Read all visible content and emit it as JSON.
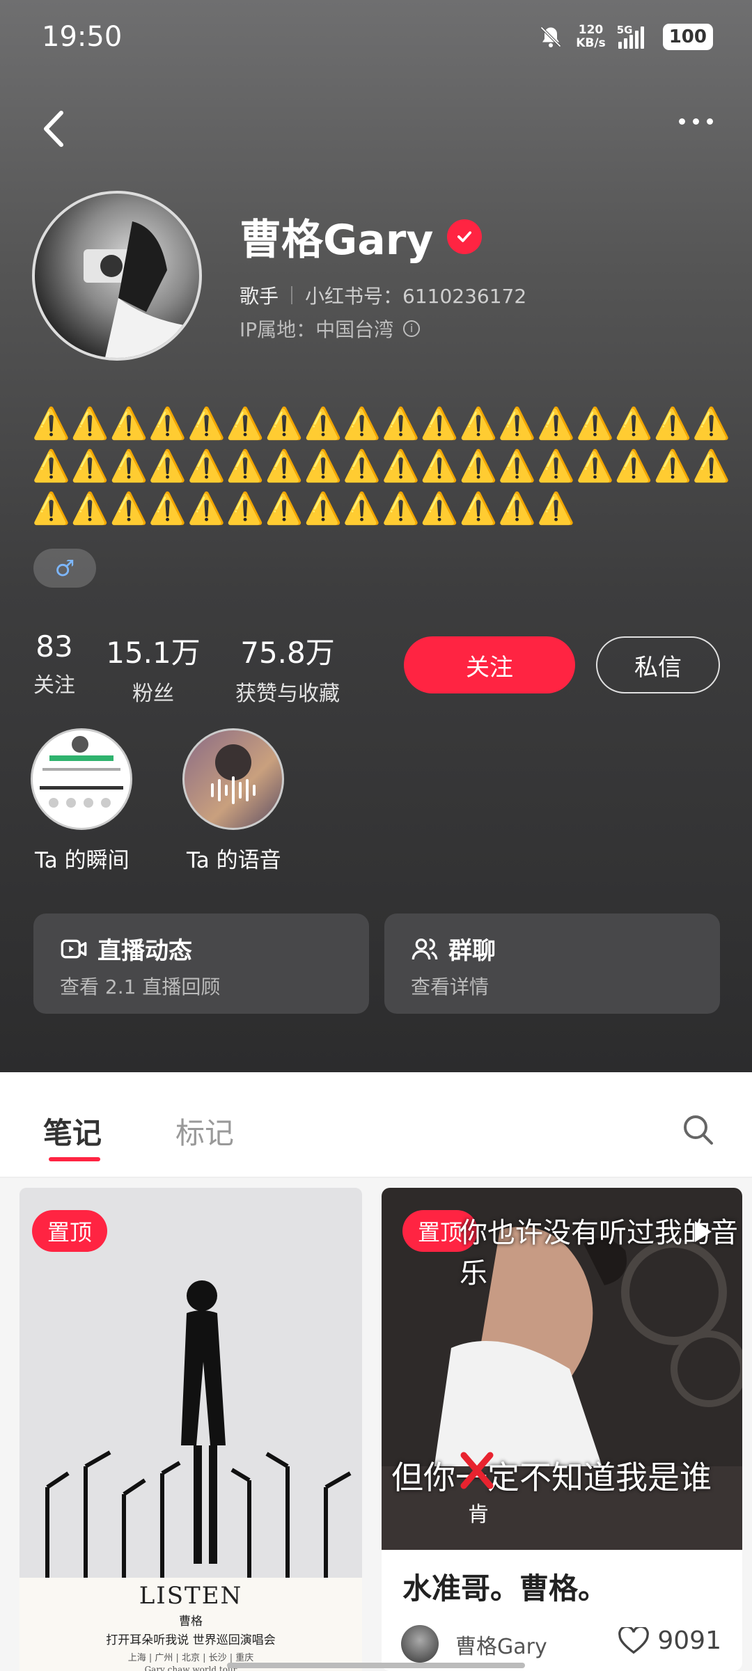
{
  "status_bar": {
    "time": "19:50",
    "speed_value": "120",
    "speed_unit": "KB/s",
    "network": "5G",
    "battery": "100"
  },
  "profile": {
    "name": "曹格Gary",
    "role": "歌手",
    "red_id": "小红书号：6110236172",
    "ip": "IP属地：中国台湾",
    "bio": "⚠️⚠️⚠️⚠️⚠️⚠️⚠️⚠️⚠️⚠️⚠️⚠️⚠️⚠️⚠️⚠️⚠️⚠️⚠️⚠️⚠️⚠️⚠️⚠️⚠️⚠️⚠️⚠️⚠️⚠️⚠️⚠️⚠️⚠️⚠️⚠️⚠️⚠️⚠️⚠️⚠️⚠️⚠️⚠️⚠️⚠️⚠️⚠️⚠️⚠️",
    "gender_symbol": "♂"
  },
  "stats": [
    {
      "num": "83",
      "label": "关注"
    },
    {
      "num": "15.1万",
      "label": "粉丝"
    },
    {
      "num": "75.8万",
      "label": "获赞与收藏"
    }
  ],
  "buttons": {
    "follow": "关注",
    "message": "私信"
  },
  "stories": [
    {
      "label": "Ta 的瞬间"
    },
    {
      "label": "Ta 的语音"
    }
  ],
  "cards": [
    {
      "title": "直播动态",
      "sub": "查看 2.1 直播回顾",
      "icon": "live-icon"
    },
    {
      "title": "群聊",
      "sub": "查看详情",
      "icon": "group-icon"
    }
  ],
  "tabs": [
    {
      "label": "笔记"
    },
    {
      "label": "标记"
    }
  ],
  "notes": [
    {
      "pin": "置顶",
      "poster_title": "LISTEN",
      "poster_name": "曹格",
      "poster_sub": "打开耳朵听我说 世界巡回演唱会",
      "poster_cities": "上海 | 广州 | 北京 | 长沙 | 重庆",
      "poster_en": "Gary chaw world tour"
    },
    {
      "pin": "置顶",
      "video_top": "你也许没有听过我的音乐",
      "video_bottom": "但你一定不知道我是谁",
      "video_sub": "肯",
      "title": "水准哥。曹格。",
      "author": "曹格Gary",
      "likes": "9091"
    }
  ],
  "colors": {
    "accent": "#ff2442"
  }
}
